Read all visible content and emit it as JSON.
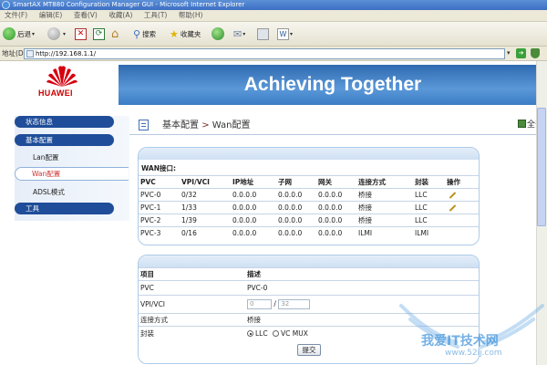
{
  "window": {
    "title": "SmartAX MT880 Configuration Manager GUI - Microsoft Internet Explorer"
  },
  "menu": [
    "文件(F)",
    "编辑(E)",
    "查看(V)",
    "收藏(A)",
    "工具(T)",
    "帮助(H)"
  ],
  "toolbar": {
    "back": "后退",
    "search": "搜索",
    "favorites": "收藏夹"
  },
  "address": {
    "label": "地址(D)",
    "url": "http://192.168.1.1/"
  },
  "header": {
    "logo": "HUAWEI",
    "banner": "Achieving Together"
  },
  "sidebar": {
    "status": "状态信息",
    "basic": "基本配置",
    "lan": "Lan配置",
    "wan": "Wan配置",
    "adsl": "ADSL模式",
    "tools": "工具"
  },
  "breadcrumb": {
    "section": "基本配置",
    "separator": ">",
    "page": "Wan配置"
  },
  "right_link": "全部",
  "wan_table": {
    "title": "WAN接口:",
    "headers": [
      "PVC",
      "VPI/VCI",
      "IP地址",
      "子网",
      "网关",
      "连接方式",
      "封装",
      "操作"
    ],
    "rows": [
      [
        "PVC-0",
        "0/32",
        "0.0.0.0",
        "0.0.0.0",
        "0.0.0.0",
        "桥接",
        "LLC"
      ],
      [
        "PVC-1",
        "1/33",
        "0.0.0.0",
        "0.0.0.0",
        "0.0.0.0",
        "桥接",
        "LLC"
      ],
      [
        "PVC-2",
        "1/39",
        "0.0.0.0",
        "0.0.0.0",
        "0.0.0.0",
        "桥接",
        "LLC"
      ],
      [
        "PVC-3",
        "0/16",
        "0.0.0.0",
        "0.0.0.0",
        "0.0.0.0",
        "ILMI",
        "ILMI"
      ]
    ],
    "editable_rows": [
      0,
      1
    ]
  },
  "detail_form": {
    "headers": [
      "项目",
      "描述"
    ],
    "pvc_label": "PVC",
    "pvc_value": "PVC-0",
    "vpivci_label": "VPI/VCI",
    "vpi_value": "0",
    "vci_value": "32",
    "slash": "/",
    "conn_label": "连接方式",
    "conn_value": "桥接",
    "encap_label": "封装",
    "encap_option1": "LLC",
    "encap_option2": "VC MUX",
    "encap_selected": "LLC",
    "submit": "提交"
  },
  "watermark": {
    "text": "我爱IT技术网",
    "url": "www.52ij.com"
  },
  "colors": {
    "banner": "#3b7cc4",
    "sidebar_pill": "#1f4d99",
    "active_item": "#cc3333",
    "panel_border": "#aecbe7"
  }
}
